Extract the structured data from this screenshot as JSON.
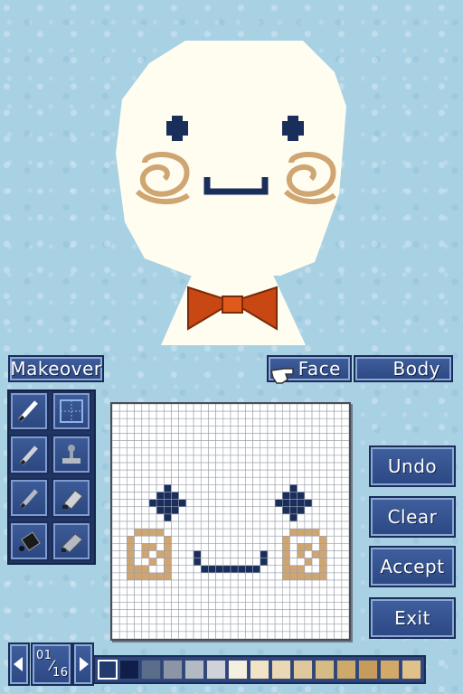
{
  "buttons": {
    "makeover": "Makeover",
    "face_tab": "Face",
    "body_tab": "Body",
    "undo": "Undo",
    "clear": "Clear",
    "accept": "Accept",
    "exit": "Exit"
  },
  "page": {
    "current": "01",
    "total": "16"
  },
  "tools": [
    "pencil-icon",
    "grid-toggle-icon",
    "pen-icon",
    "stamp-icon",
    "brush-icon",
    "eraser-icon",
    "paint-bucket-icon",
    "large-eraser-icon"
  ],
  "palette": [
    "#233a6e",
    "#0f1f4a",
    "#5a6d8a",
    "#8c95a6",
    "#b4bac4",
    "#cfd3d9",
    "#f5efdf",
    "#f0e3c7",
    "#e9d8b3",
    "#dfc89b",
    "#d7bb85",
    "#cfa86c",
    "#c79b5b",
    "#d3a96a",
    "#e1c18a"
  ],
  "colors": {
    "navy": "#1a2e5c",
    "tan": "#cfa572",
    "face": "#fffdf0",
    "bow": "#c94712"
  }
}
